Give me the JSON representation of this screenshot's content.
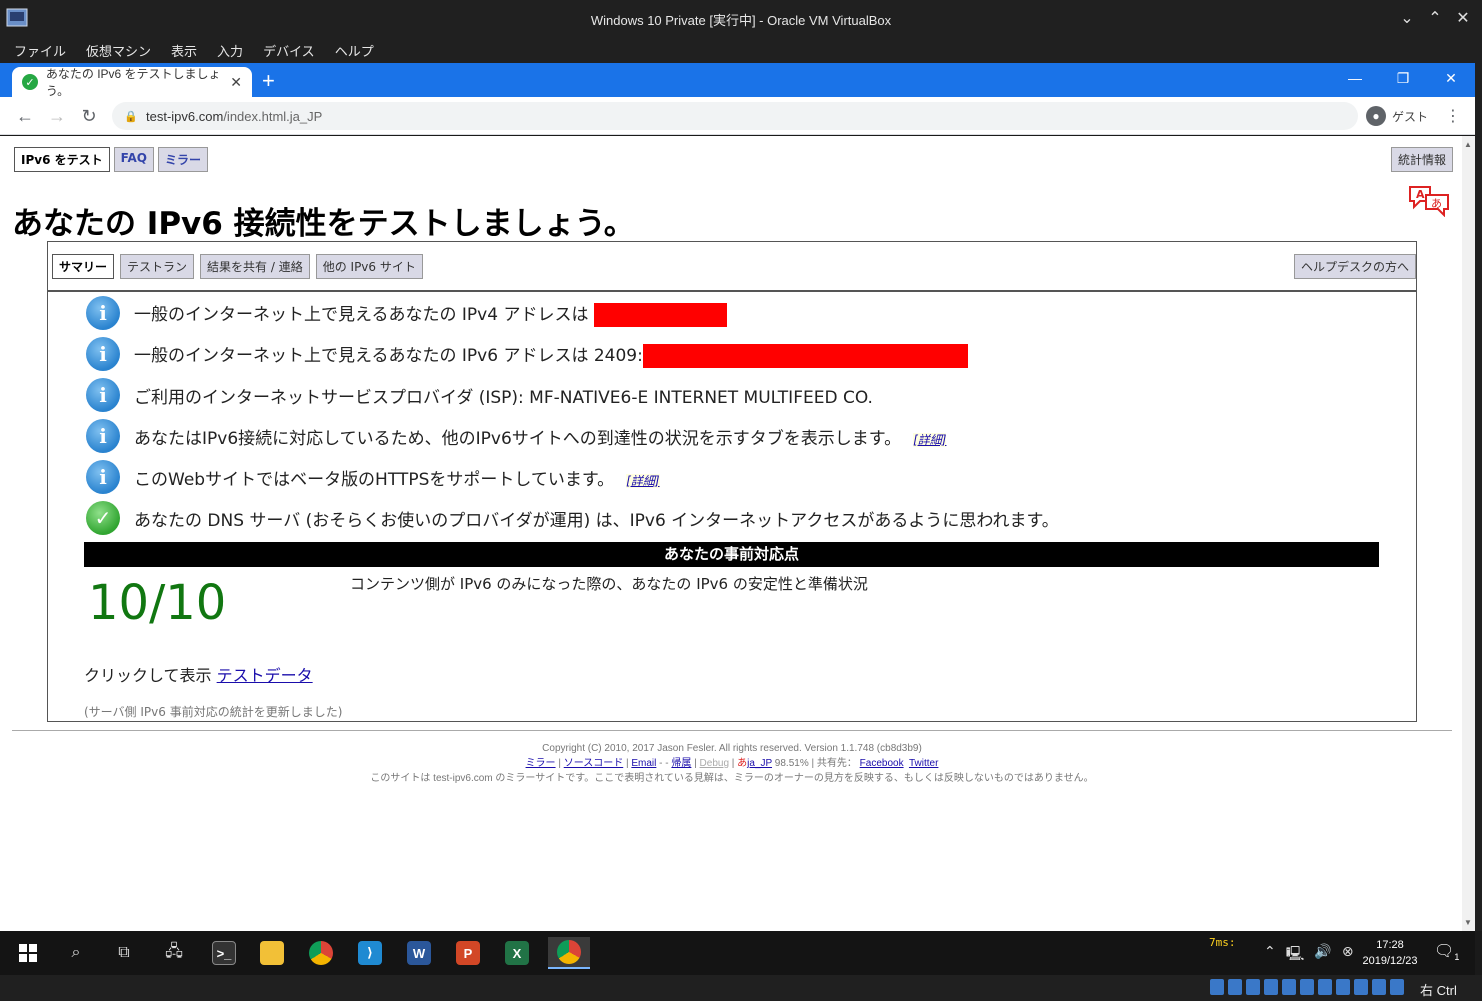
{
  "vbox": {
    "title": "Windows 10 Private [実行中] - Oracle VM VirtualBox",
    "menu": [
      "ファイル",
      "仮想マシン",
      "表示",
      "入力",
      "デバイス",
      "ヘルプ"
    ],
    "host_key": "右 Ctrl"
  },
  "browser": {
    "tab_title": "あなたの IPv6 をテストしましょう。",
    "url_host": "test-ipv6.com",
    "url_path": "/index.html.ja_JP",
    "profile_label": "ゲスト"
  },
  "page": {
    "top_tabs": [
      "IPv6 をテスト",
      "FAQ",
      "ミラー"
    ],
    "stats_tab": "統計情報",
    "headline": "あなたの IPv6 接続性をテストしましょう。",
    "sub_tabs": [
      "サマリー",
      "テストラン",
      "結果を共有 / 連絡",
      "他の IPv6 サイト"
    ],
    "helpdesk_tab": "ヘルプデスクの方へ",
    "results": {
      "ipv4": "一般のインターネット上で見えるあなたの IPv4 アドレスは",
      "ipv6": "一般のインターネット上で見えるあなたの IPv6 アドレスは 2409:",
      "isp": "ご利用のインターネットサービスプロバイダ (ISP): MF-NATIVE6-E INTERNET MULTIFEED CO.",
      "ipv6_tabs": "あなたはIPv6接続に対応しているため、他のIPv6サイトへの到達性の状況を示すタブを表示します。",
      "https_beta": "このWebサイトではベータ版のHTTPSをサポートしています。",
      "dns": "あなたの DNS サーバ (おそらくお使いのプロバイダが運用) は、IPv6 インターネットアクセスがあるように思われます。",
      "detail_link": "[詳細]"
    },
    "score_header": "あなたの事前対応点",
    "score": "10/10",
    "score_desc": "コンテンツ側が IPv6 のみになった際の、あなたの IPv6 の安定性と準備状況",
    "click_prefix": "クリックして表示",
    "click_link": "テストデータ",
    "server_note": "(サーバ側 IPv6 事前対応の統計を更新しました)"
  },
  "footer": {
    "copyright": "Copyright (C) 2010, 2017 Jason Fesler. All rights reserved. Version 1.1.748 (cb8d3b9)",
    "links": {
      "mirror": "ミラー",
      "source": "ソースコード",
      "email": "Email",
      "attribution": "帰属",
      "debug": "Debug",
      "locale": "ja_JP",
      "percent": "98.51%",
      "share_label": "共有先：",
      "facebook": "Facebook",
      "twitter": "Twitter"
    },
    "mirror_note": "このサイトは test-ipv6.com のミラーサイトです。ここで表明されている見解は、ミラーのオーナーの見方を反映する、もしくは反映しないものではありません。"
  },
  "taskbar": {
    "ping": "7ms:",
    "time": "17:28",
    "date": "2019/12/23",
    "notifications": "1"
  },
  "colors": {
    "chrome_blue": "#1a73e8",
    "score_green": "#117711",
    "redaction": "#ff0000"
  }
}
